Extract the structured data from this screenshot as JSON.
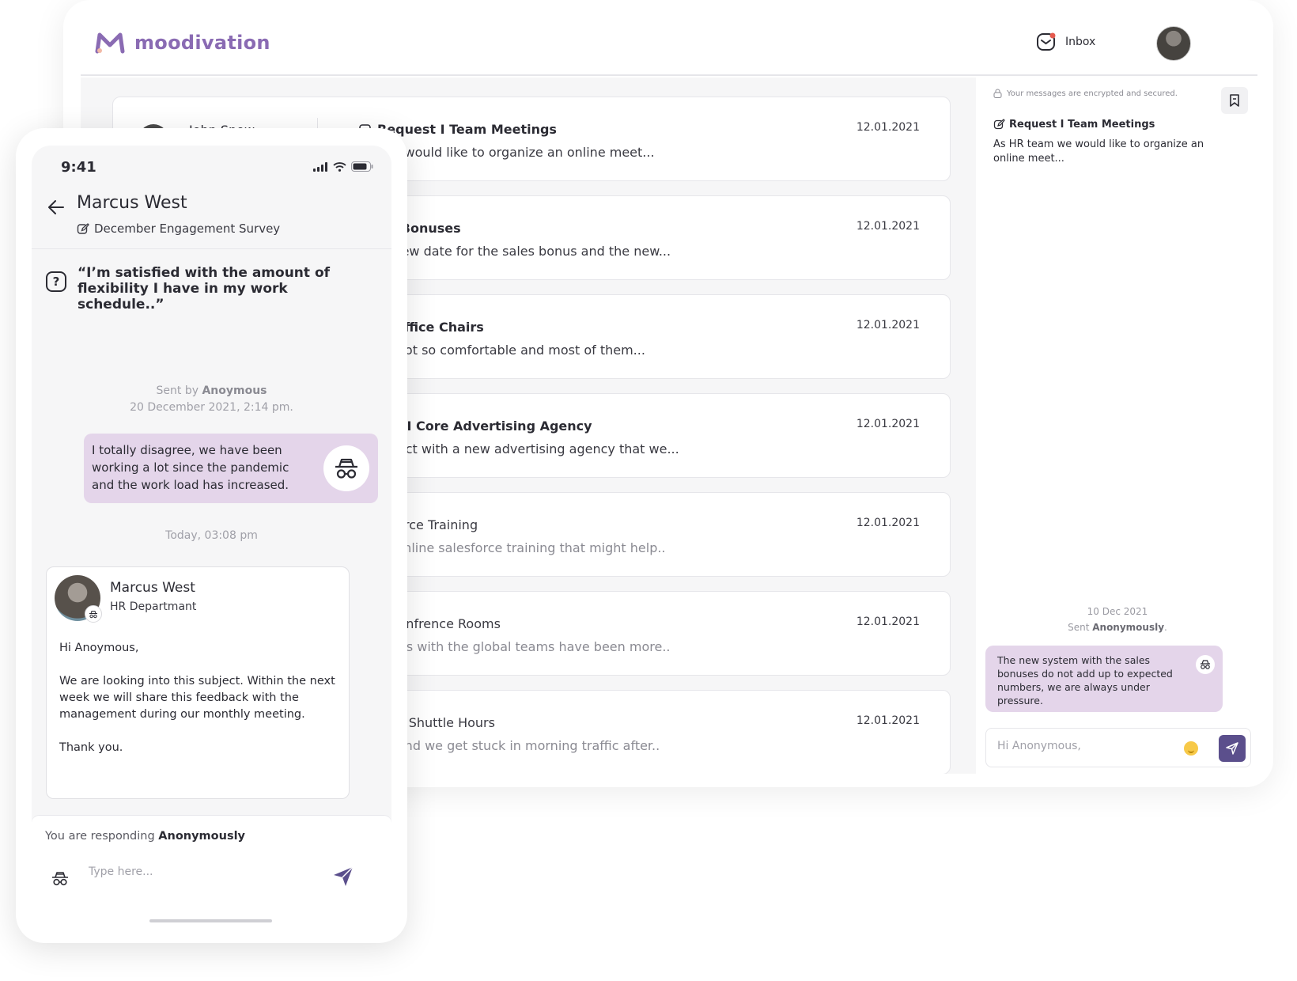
{
  "desktop": {
    "brand": "moodivation",
    "colors": {
      "brand": "#8a6bb3",
      "bubble": "#e4d5ea",
      "send": "#5b4f8c",
      "emoji": "#f7c948"
    },
    "header": {
      "inbox_label": "Inbox",
      "inbox_icon": "mail-icon",
      "avatar": "user-avatar"
    },
    "messages": [
      {
        "sender": "John Snow",
        "title": "Request I Team Meetings",
        "preview": "am we would like to organize an online meet...",
        "date": "12.01.2021"
      },
      {
        "title": "Sales Bonuses",
        "preview": "set a new date for the sales bonus and the new...",
        "date": "12.01.2021"
      },
      {
        "title": "New Office Chairs",
        "preview": "'s are not so comfortable and most of them...",
        "date": "12.01.2021"
      },
      {
        "title": "estion I Core Advertising Agency",
        "preview": "a contact with a new advertising agency that we...",
        "date": "12.01.2021"
      },
      {
        "title": "Salesforce Training",
        "preview": "great online salesforce training that might help..",
        "date": "12.01.2021"
      },
      {
        "title": "est I Confrence Rooms",
        "preview": "neetings with the global teams have been more..",
        "date": "12.01.2021"
      },
      {
        "title": "estion I Shuttle Hours",
        "preview": "s late and we get stuck in morning traffic after..",
        "date": "12.01.2021"
      }
    ],
    "detail": {
      "encrypted_note": "Your messages are encrypted and secured.",
      "title": "Request I Team Meetings",
      "text": "As HR team we would like to organize an online meet...",
      "date": "10 Dec 2021",
      "sent_prefix": "Sent ",
      "sent_who": "Anonymously",
      "sent_suffix": ".",
      "bubble": "The new system with the sales bonuses do not add up to expected numbers, we are always under pressure.",
      "input_placeholder": "Hi Anonymous,"
    }
  },
  "mobile": {
    "time": "9:41",
    "contact_name": "Marcus West",
    "survey": "December Engagement Survey",
    "question": "“I’m satisfied with the amount of flexibility I have in my work schedule..”",
    "question_icon": "?",
    "sent_by_prefix": "Sent by ",
    "sent_by_name": "Anoymous",
    "sent_date": "20 December 2021, 2:14 pm.",
    "bubble": "I totally disagree, we have been working a lot since the pandemic and the work load has increased.",
    "today": "Today, 03:08 pm",
    "reply": {
      "name": "Marcus West",
      "department": "HR Departmant",
      "body": "Hi Anoymous,\n\nWe are looking into this subject. Within the next week we will share this feedback with the management during our monthly meeting.\n\nThank you."
    },
    "responding_prefix": "You are responding ",
    "responding_mode": "Anonymously",
    "input_placeholder": "Type here..."
  }
}
